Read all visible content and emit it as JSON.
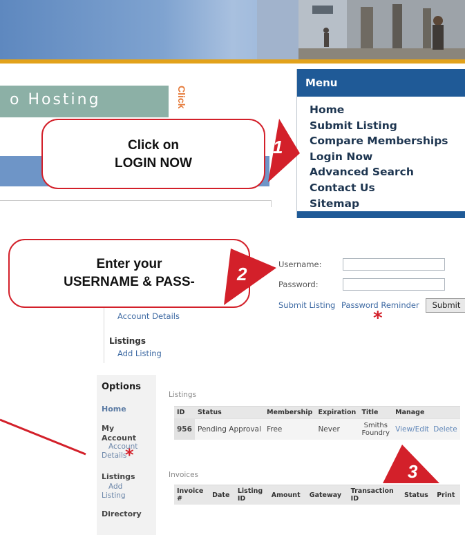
{
  "header": {
    "hosting_text": "o Hosting",
    "click_vertical": "Click"
  },
  "menu": {
    "title": "Menu",
    "items": [
      {
        "label": "Home"
      },
      {
        "label": "Submit Listing"
      },
      {
        "label": "Compare Memberships"
      },
      {
        "label": "Login Now"
      },
      {
        "label": "Advanced Search"
      },
      {
        "label": "Contact Us"
      },
      {
        "label": "Sitemap"
      }
    ]
  },
  "callouts": {
    "step1": {
      "line1": "Click on",
      "line2": "LOGIN NOW",
      "badge": "1"
    },
    "step2": {
      "line1": "Enter your",
      "line2": "USERNAME & PASS-",
      "badge": "2"
    },
    "step3": {
      "badge": "3"
    }
  },
  "login": {
    "username_label": "Username:",
    "password_label": "Password:",
    "submit_listing_link": "Submit Listing",
    "password_reminder_link": "Password Reminder",
    "submit_button": "Submit",
    "account_details_link": "Account Details",
    "listings_heading": "Listings",
    "add_listing_link": "Add Listing",
    "asterisk": "*"
  },
  "account": {
    "options_title": "Options",
    "home": "Home",
    "my_account_line1": "My",
    "my_account_line2": "Account",
    "account_details_line1": "Account",
    "account_details_line2": "Details",
    "listings": "Listings",
    "add_line1": "Add",
    "add_line2": "Listing",
    "directory": "Directory",
    "asterisk": "*"
  },
  "listings_table": {
    "title": "Listings",
    "headers": [
      "ID",
      "Status",
      "Membership",
      "Expiration",
      "Title",
      "Manage"
    ],
    "row": {
      "id": "956",
      "status": "Pending Approval",
      "membership": "Free",
      "expiration": "Never",
      "title_line1": "Smiths",
      "title_line2": "Foundry",
      "view_edit": "View/Edit",
      "delete": "Delete"
    }
  },
  "invoices_table": {
    "title": "Invoices",
    "headers": {
      "invoice_line1": "Invoice",
      "invoice_line2": "#",
      "date": "Date",
      "listing_line1": "Listing",
      "listing_line2": "ID",
      "amount": "Amount",
      "gateway": "Gateway",
      "transaction_line1": "Transaction",
      "transaction_line2": "ID",
      "status": "Status",
      "print": "Print"
    }
  },
  "colors": {
    "accent_red": "#d3202a",
    "menu_blue": "#1f5a97",
    "link_blue": "#3e6aa3",
    "banner_yellow": "#e2a21b"
  }
}
